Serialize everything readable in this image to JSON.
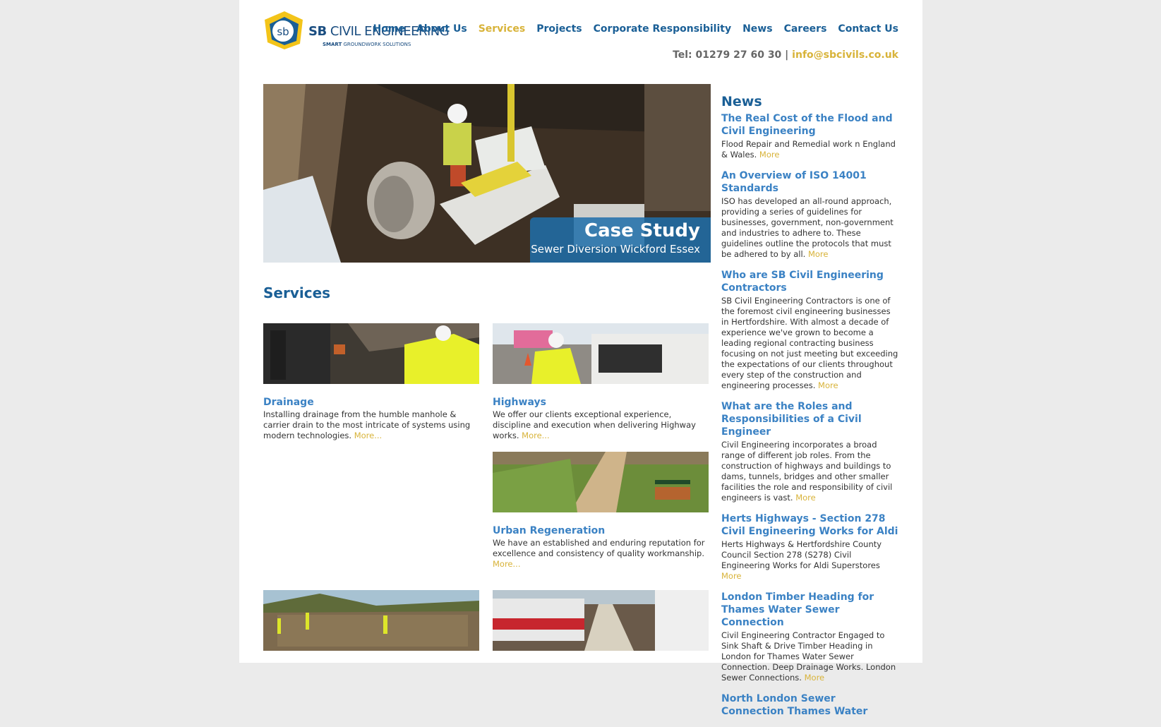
{
  "nav": {
    "items": [
      {
        "label": "Home",
        "active": false
      },
      {
        "label": "About Us",
        "active": false
      },
      {
        "label": "Services",
        "active": true
      },
      {
        "label": "Projects",
        "active": false
      },
      {
        "label": "Corporate Responsibility",
        "active": false
      },
      {
        "label": "News",
        "active": false
      },
      {
        "label": "Careers",
        "active": false
      },
      {
        "label": "Contact Us",
        "active": false
      }
    ]
  },
  "logo": {
    "mark": "sb",
    "name_bold": "SB",
    "name_rest": " CIVIL ENGINEERING",
    "tagline_bold": "SMART",
    "tagline_rest": " GROUNDWORK SOLUTIONS"
  },
  "contact": {
    "tel_label": "Tel: 01279 27 60 30",
    "separator": "|",
    "email": "info@sbcivils.co.uk"
  },
  "hero": {
    "title": "Case Study",
    "subtitle": "Sewer Diversion Wickford Essex"
  },
  "services": {
    "title": "Services",
    "items": [
      {
        "name": "Drainage",
        "desc": "Installing drainage from the humble manhole & carrier drain to the most intricate of systems using modern technologies.",
        "more": "More..."
      },
      {
        "name": "Highways",
        "desc": "We offer our clients exceptional experience, discipline and execution when delivering Highway works.",
        "more": "More..."
      },
      {
        "name": "Urban Regeneration",
        "desc": "We have an established and enduring reputation for excellence and consistency of quality workmanship.",
        "more": "More..."
      }
    ]
  },
  "news": {
    "title": "News",
    "items": [
      {
        "title": "The Real Cost of the Flood and Civil Engineering",
        "desc": "Flood Repair and Remedial work n England & Wales.",
        "more": "More"
      },
      {
        "title": "An Overview of ISO 14001 Standards",
        "desc": "ISO has developed an all-round approach, providing a series of guidelines for businesses, government, non-government and industries to adhere to. These guidelines outline the protocols that must be adhered to by all.",
        "more": "More"
      },
      {
        "title": "Who are SB Civil Engineering Contractors",
        "desc": "SB Civil Engineering Contractors is one of the foremost civil engineering businesses in Hertfordshire. With almost a decade of experience we've grown to become a leading regional contracting business focusing on not just meeting but exceeding the expectations of our clients throughout every step of the construction and engineering processes.",
        "more": "More"
      },
      {
        "title": "What are the Roles and Responsibilities of a Civil Engineer",
        "desc": "Civil Engineering incorporates a broad range of different job roles. From the construction of highways and buildings to dams, tunnels, bridges and other smaller facilities the role and responsibility of civil engineers is vast.",
        "more": "More"
      },
      {
        "title": "Herts Highways - Section 278 Civil Engineering Works for Aldi",
        "desc": "Herts Highways & Hertfordshire County Council Section 278 (S278) Civil Engineering Works for Aldi Superstores",
        "more": "More"
      },
      {
        "title": "London Timber Heading for Thames Water Sewer Connection",
        "desc": "Civil Engineering Contractor Engaged to Sink Shaft & Drive Timber Heading in London for Thames Water Sewer Connection. Deep Drainage Works. London Sewer Connections.",
        "more": "More"
      },
      {
        "title": "North London Sewer Connection Thames Water",
        "desc": "",
        "more": ""
      }
    ]
  },
  "colors": {
    "brand_blue": "#1a5f96",
    "link_blue": "#3b82c4",
    "accent_gold": "#d8b339",
    "page_bg": "#ebebeb"
  }
}
